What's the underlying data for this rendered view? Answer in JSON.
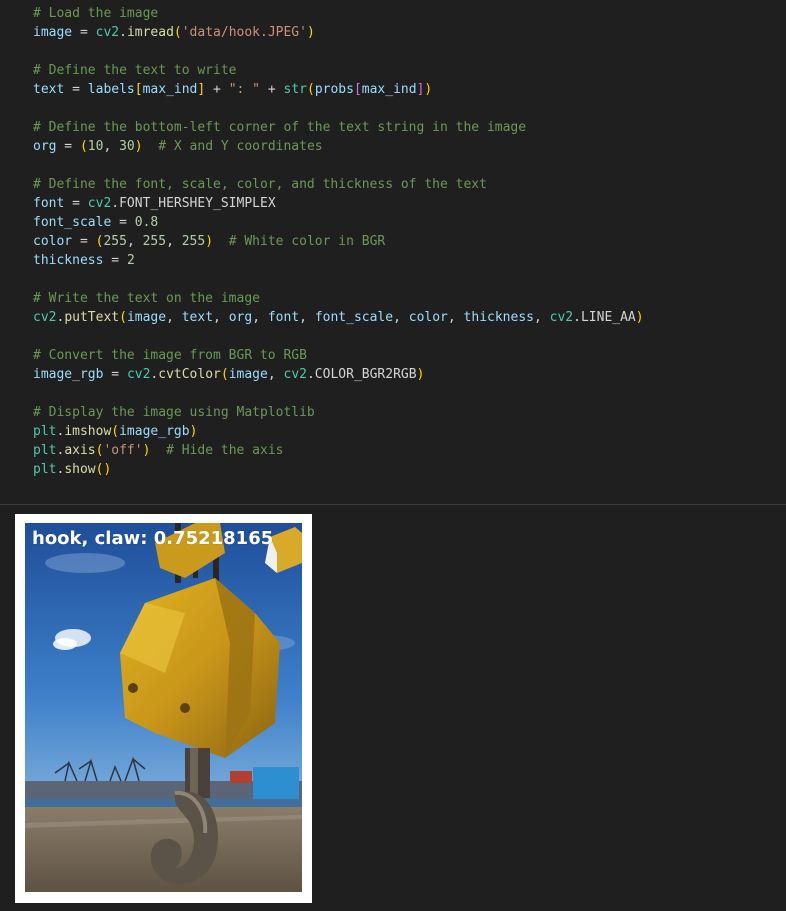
{
  "code_cell": {
    "lines": [
      [
        {
          "t": "# Load the image",
          "k": "c"
        }
      ],
      [
        {
          "t": "image",
          "k": "v"
        },
        {
          "t": " = ",
          "k": "op"
        },
        {
          "t": "cv2",
          "k": "cls"
        },
        {
          "t": ".",
          "k": "op"
        },
        {
          "t": "imread",
          "k": "f"
        },
        {
          "t": "(",
          "k": "b1"
        },
        {
          "t": "'data/hook.JPEG'",
          "k": "s"
        },
        {
          "t": ")",
          "k": "b1"
        }
      ],
      [],
      [
        {
          "t": "# Define the text to write",
          "k": "c"
        }
      ],
      [
        {
          "t": "text",
          "k": "v"
        },
        {
          "t": " = ",
          "k": "op"
        },
        {
          "t": "labels",
          "k": "v"
        },
        {
          "t": "[",
          "k": "b1"
        },
        {
          "t": "max_ind",
          "k": "v"
        },
        {
          "t": "]",
          "k": "b1"
        },
        {
          "t": " + ",
          "k": "op"
        },
        {
          "t": "\": \"",
          "k": "s"
        },
        {
          "t": " + ",
          "k": "op"
        },
        {
          "t": "str",
          "k": "cls"
        },
        {
          "t": "(",
          "k": "b1"
        },
        {
          "t": "probs",
          "k": "v"
        },
        {
          "t": "[",
          "k": "b2"
        },
        {
          "t": "max_ind",
          "k": "v"
        },
        {
          "t": "]",
          "k": "b2"
        },
        {
          "t": ")",
          "k": "b1"
        }
      ],
      [],
      [
        {
          "t": "# Define the bottom-left corner of the text string in the image",
          "k": "c"
        }
      ],
      [
        {
          "t": "org",
          "k": "v"
        },
        {
          "t": " = ",
          "k": "op"
        },
        {
          "t": "(",
          "k": "b1"
        },
        {
          "t": "10",
          "k": "n"
        },
        {
          "t": ", ",
          "k": "op"
        },
        {
          "t": "30",
          "k": "n"
        },
        {
          "t": ")",
          "k": "b1"
        },
        {
          "t": "  ",
          "k": "op"
        },
        {
          "t": "# X and Y coordinates",
          "k": "c"
        }
      ],
      [],
      [
        {
          "t": "# Define the font, scale, color, and thickness of the text",
          "k": "c"
        }
      ],
      [
        {
          "t": "font",
          "k": "v"
        },
        {
          "t": " = ",
          "k": "op"
        },
        {
          "t": "cv2",
          "k": "cls"
        },
        {
          "t": ".FONT_HERSHEY_SIMPLEX",
          "k": "op"
        }
      ],
      [
        {
          "t": "font_scale",
          "k": "v"
        },
        {
          "t": " = ",
          "k": "op"
        },
        {
          "t": "0.8",
          "k": "n"
        }
      ],
      [
        {
          "t": "color",
          "k": "v"
        },
        {
          "t": " = ",
          "k": "op"
        },
        {
          "t": "(",
          "k": "b1"
        },
        {
          "t": "255",
          "k": "n"
        },
        {
          "t": ", ",
          "k": "op"
        },
        {
          "t": "255",
          "k": "n"
        },
        {
          "t": ", ",
          "k": "op"
        },
        {
          "t": "255",
          "k": "n"
        },
        {
          "t": ")",
          "k": "b1"
        },
        {
          "t": "  ",
          "k": "op"
        },
        {
          "t": "# White color in BGR",
          "k": "c"
        }
      ],
      [
        {
          "t": "thickness",
          "k": "v"
        },
        {
          "t": " = ",
          "k": "op"
        },
        {
          "t": "2",
          "k": "n"
        }
      ],
      [],
      [
        {
          "t": "# Write the text on the image",
          "k": "c"
        }
      ],
      [
        {
          "t": "cv2",
          "k": "cls"
        },
        {
          "t": ".",
          "k": "op"
        },
        {
          "t": "putText",
          "k": "f"
        },
        {
          "t": "(",
          "k": "b1"
        },
        {
          "t": "image",
          "k": "v"
        },
        {
          "t": ", ",
          "k": "op"
        },
        {
          "t": "text",
          "k": "v"
        },
        {
          "t": ", ",
          "k": "op"
        },
        {
          "t": "org",
          "k": "v"
        },
        {
          "t": ", ",
          "k": "op"
        },
        {
          "t": "font",
          "k": "v"
        },
        {
          "t": ", ",
          "k": "op"
        },
        {
          "t": "font_scale",
          "k": "v"
        },
        {
          "t": ", ",
          "k": "op"
        },
        {
          "t": "color",
          "k": "v"
        },
        {
          "t": ", ",
          "k": "op"
        },
        {
          "t": "thickness",
          "k": "v"
        },
        {
          "t": ", ",
          "k": "op"
        },
        {
          "t": "cv2",
          "k": "cls"
        },
        {
          "t": ".LINE_AA",
          "k": "op"
        },
        {
          "t": ")",
          "k": "b1"
        }
      ],
      [],
      [
        {
          "t": "# Convert the image from BGR to RGB",
          "k": "c"
        }
      ],
      [
        {
          "t": "image_rgb",
          "k": "v"
        },
        {
          "t": " = ",
          "k": "op"
        },
        {
          "t": "cv2",
          "k": "cls"
        },
        {
          "t": ".",
          "k": "op"
        },
        {
          "t": "cvtColor",
          "k": "f"
        },
        {
          "t": "(",
          "k": "b1"
        },
        {
          "t": "image",
          "k": "v"
        },
        {
          "t": ", ",
          "k": "op"
        },
        {
          "t": "cv2",
          "k": "cls"
        },
        {
          "t": ".COLOR_BGR2RGB",
          "k": "op"
        },
        {
          "t": ")",
          "k": "b1"
        }
      ],
      [],
      [
        {
          "t": "# Display the image using Matplotlib",
          "k": "c"
        }
      ],
      [
        {
          "t": "plt",
          "k": "cls"
        },
        {
          "t": ".",
          "k": "op"
        },
        {
          "t": "imshow",
          "k": "f"
        },
        {
          "t": "(",
          "k": "b1"
        },
        {
          "t": "image_rgb",
          "k": "v"
        },
        {
          "t": ")",
          "k": "b1"
        }
      ],
      [
        {
          "t": "plt",
          "k": "cls"
        },
        {
          "t": ".",
          "k": "op"
        },
        {
          "t": "axis",
          "k": "f"
        },
        {
          "t": "(",
          "k": "b1"
        },
        {
          "t": "'off'",
          "k": "s"
        },
        {
          "t": ")",
          "k": "b1"
        },
        {
          "t": "  ",
          "k": "op"
        },
        {
          "t": "# Hide the axis",
          "k": "c"
        }
      ],
      [
        {
          "t": "plt",
          "k": "cls"
        },
        {
          "t": ".",
          "k": "op"
        },
        {
          "t": "show",
          "k": "f"
        },
        {
          "t": "()",
          "k": "b1"
        }
      ]
    ]
  },
  "output": {
    "image_label": "hook, claw: 0.75218165"
  },
  "colors": {
    "background": "#1f1f1f",
    "comment": "#6a9955",
    "variable": "#9cdcfe",
    "string": "#ce9178",
    "number": "#b5cea8",
    "function": "#dcdcaa"
  }
}
